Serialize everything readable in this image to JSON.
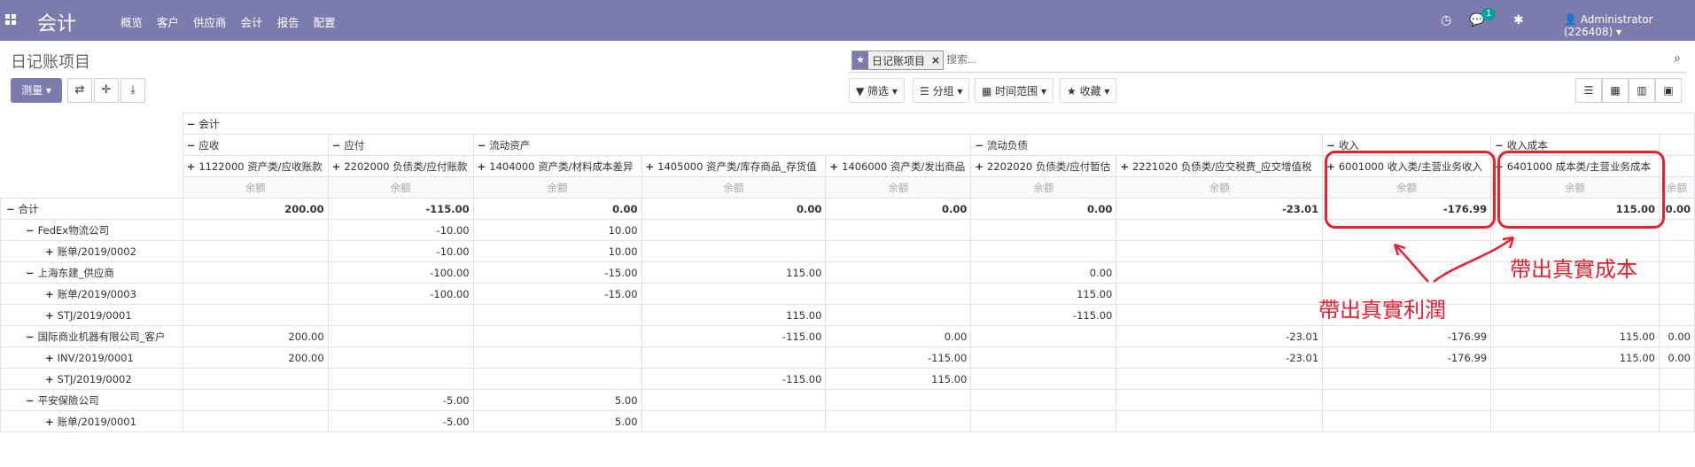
{
  "navbar": {
    "brand": "会计",
    "menu": [
      "概览",
      "客户",
      "供应商",
      "会计",
      "报告",
      "配置"
    ],
    "messages_badge": "1",
    "user": "Administrator (226408)"
  },
  "control": {
    "title": "日记账项目",
    "measure_label": "测量",
    "search": {
      "facet": "日记账项目",
      "placeholder": "搜索..."
    },
    "filters_label": "筛选",
    "groupby_label": "分组",
    "timerange_label": "时间范围",
    "favorites_label": "收藏"
  },
  "pivot": {
    "root_col": "会计",
    "groups": [
      {
        "label": "应收"
      },
      {
        "label": "应付"
      },
      {
        "label": "流动资产"
      },
      {
        "label": "流动负债"
      },
      {
        "label": "收入"
      },
      {
        "label": "收入成本"
      }
    ],
    "accounts": [
      "1122000 资产类/应收账款",
      "2202000 负债类/应付账款",
      "1404000 资产类/材料成本差异",
      "1405000 资产类/库存商品_存货值",
      "1406000 资产类/发出商品",
      "2202020 负债类/应付暂估",
      "2221020 负债类/应交税费_应交增值税",
      "6001000 收入类/主营业务收入",
      "6401000 成本类/主营业务成本"
    ],
    "measure": "余额",
    "rows": [
      {
        "label": "合计",
        "level": 0,
        "sign": "−",
        "values": [
          "200.00",
          "-115.00",
          "0.00",
          "0.00",
          "0.00",
          "0.00",
          "-23.01",
          "-176.99",
          "115.00",
          "0.00"
        ]
      },
      {
        "label": "FedEx物流公司",
        "level": 1,
        "sign": "−",
        "values": [
          "",
          "-10.00",
          "10.00",
          "",
          "",
          "",
          "",
          "",
          "",
          ""
        ]
      },
      {
        "label": "账单/2019/0002",
        "level": 2,
        "sign": "+",
        "values": [
          "",
          "-10.00",
          "10.00",
          "",
          "",
          "",
          "",
          "",
          "",
          ""
        ]
      },
      {
        "label": "上海东建_供应商",
        "level": 1,
        "sign": "−",
        "values": [
          "",
          "-100.00",
          "-15.00",
          "115.00",
          "",
          "0.00",
          "",
          "",
          "",
          ""
        ]
      },
      {
        "label": "账单/2019/0003",
        "level": 2,
        "sign": "+",
        "values": [
          "",
          "-100.00",
          "-15.00",
          "",
          "",
          "115.00",
          "",
          "",
          "",
          ""
        ]
      },
      {
        "label": "STJ/2019/0001",
        "level": 2,
        "sign": "+",
        "values": [
          "",
          "",
          "",
          "115.00",
          "",
          "-115.00",
          "",
          "",
          "",
          ""
        ]
      },
      {
        "label": "国际商业机器有限公司_客户",
        "level": 1,
        "sign": "−",
        "values": [
          "200.00",
          "",
          "",
          "-115.00",
          "0.00",
          "",
          "-23.01",
          "-176.99",
          "115.00",
          "0.00"
        ]
      },
      {
        "label": "INV/2019/0001",
        "level": 2,
        "sign": "+",
        "values": [
          "200.00",
          "",
          "",
          "",
          "-115.00",
          "",
          "-23.01",
          "-176.99",
          "115.00",
          "0.00"
        ]
      },
      {
        "label": "STJ/2019/0002",
        "level": 2,
        "sign": "+",
        "values": [
          "",
          "",
          "",
          "-115.00",
          "115.00",
          "",
          "",
          "",
          "",
          ""
        ]
      },
      {
        "label": "平安保險公司",
        "level": 1,
        "sign": "−",
        "values": [
          "",
          "-5.00",
          "5.00",
          "",
          "",
          "",
          "",
          "",
          "",
          ""
        ]
      },
      {
        "label": "账单/2019/0001",
        "level": 2,
        "sign": "+",
        "values": [
          "",
          "-5.00",
          "5.00",
          "",
          "",
          "",
          "",
          "",
          "",
          ""
        ]
      }
    ]
  },
  "annotations": {
    "profit": "帶出真實利潤",
    "cost": "帶出真實成本"
  },
  "colors": {
    "navbar": "#7c7bad",
    "annotation": "#e8202f"
  }
}
